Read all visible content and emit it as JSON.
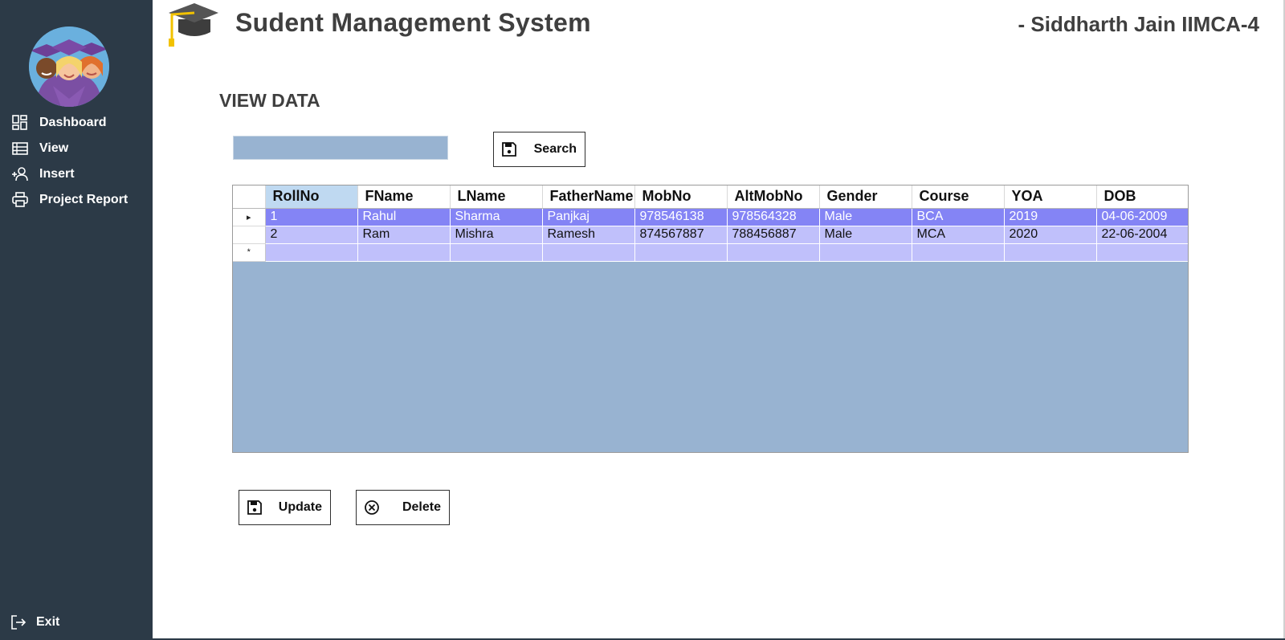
{
  "header": {
    "title": "Sudent Management System",
    "author": "- Siddharth Jain IIMCA-4"
  },
  "sidebar": {
    "items": [
      {
        "label": "Dashboard",
        "icon": "dashboard-icon"
      },
      {
        "label": "View",
        "icon": "list-icon"
      },
      {
        "label": "Insert",
        "icon": "add-user-icon"
      },
      {
        "label": "Project Report",
        "icon": "printer-icon"
      }
    ],
    "exit_label": "Exit"
  },
  "main": {
    "section_title": "VIEW DATA",
    "search": {
      "value": "",
      "button_label": "Search"
    },
    "grid": {
      "columns": [
        "RollNo",
        "FName",
        "LName",
        "FatherName",
        "MobNo",
        "AltMobNo",
        "Gender",
        "Course",
        "YOA",
        "DOB"
      ],
      "rows": [
        [
          "1",
          "Rahul",
          "Sharma",
          "Panjkaj",
          "978546138",
          "978564328",
          "Male",
          "BCA",
          "2019",
          "04-06-2009"
        ],
        [
          "2",
          "Ram",
          "Mishra",
          "Ramesh",
          "874567887",
          "788456887",
          "Male",
          "MCA",
          "2020",
          "22-06-2004"
        ]
      ],
      "selected_row_marker": "▸",
      "new_row_marker": "*"
    },
    "update_label": "Update",
    "delete_label": "Delete"
  },
  "colors": {
    "sidebar_bg": "#2c3a47",
    "grid_bg": "#98b3d1",
    "row_selected": "#8484f5",
    "row_normal": "#c0c0fb",
    "header_selected": "#bfd9f1"
  }
}
